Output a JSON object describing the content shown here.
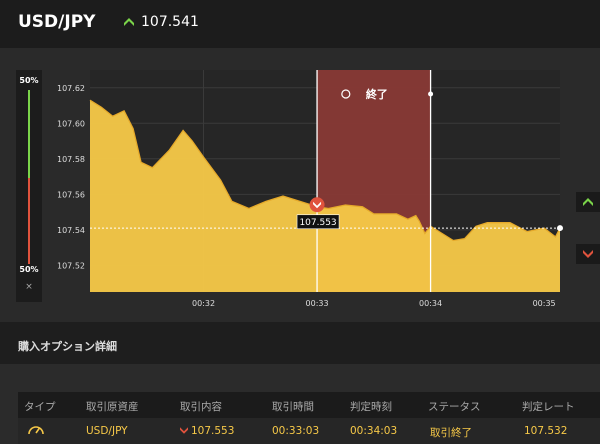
{
  "header": {
    "symbol": "USD/JPY",
    "rate": "107.541",
    "trend": "up",
    "colors": {
      "up": "#7bd44a",
      "down": "#e0533d"
    }
  },
  "ratio": {
    "high": "50%",
    "low": "50%",
    "close": "×"
  },
  "chart_data": {
    "type": "area",
    "color": "#f7c948",
    "y_ticks": [
      "107.62",
      "107.60",
      "107.58",
      "107.56",
      "107.54",
      "107.52"
    ],
    "ylim": [
      107.505,
      107.63
    ],
    "x_ticks": [
      "00:32",
      "00:33",
      "00:34",
      "00:35"
    ],
    "xlim": [
      0,
      4.14
    ],
    "series": [
      {
        "x": [
          0,
          0.1,
          0.2,
          0.3,
          0.38,
          0.45,
          0.55,
          0.7,
          0.82,
          0.9,
          1.0,
          1.15,
          1.25,
          1.4,
          1.55,
          1.7,
          1.85,
          2.0,
          2.1,
          2.25,
          2.4,
          2.5,
          2.7,
          2.8,
          2.87,
          2.9,
          2.95,
          3.0,
          3.2,
          3.3,
          3.4,
          3.5,
          3.7,
          3.85,
          4.0,
          4.1,
          4.14
        ],
        "y": [
          107.613,
          107.609,
          107.604,
          107.607,
          107.597,
          107.578,
          107.575,
          107.585,
          107.596,
          107.59,
          107.581,
          107.568,
          107.556,
          107.552,
          107.556,
          107.559,
          107.556,
          107.553,
          107.552,
          107.554,
          107.553,
          107.549,
          107.549,
          107.546,
          107.548,
          107.545,
          107.538,
          107.542,
          107.534,
          107.535,
          107.542,
          107.544,
          107.544,
          107.539,
          107.541,
          107.536,
          107.541
        ]
      }
    ],
    "current_rate": 107.541,
    "entry": {
      "x": 2.0,
      "y": 107.553,
      "label": "107.553"
    },
    "period": {
      "start": 2.0,
      "end": 3.0,
      "label": "終了"
    }
  },
  "details": {
    "title": "購入オプション詳細",
    "columns": [
      "タイプ",
      "取引原資産",
      "取引内容",
      "取引時間",
      "判定時刻",
      "ステータス",
      "判定レート"
    ],
    "row": {
      "asset": "USD/JPY",
      "content": "107.553",
      "time": "00:33:03",
      "judge_time": "00:34:03",
      "status": "取引終了",
      "judge_rate": "107.532"
    }
  }
}
